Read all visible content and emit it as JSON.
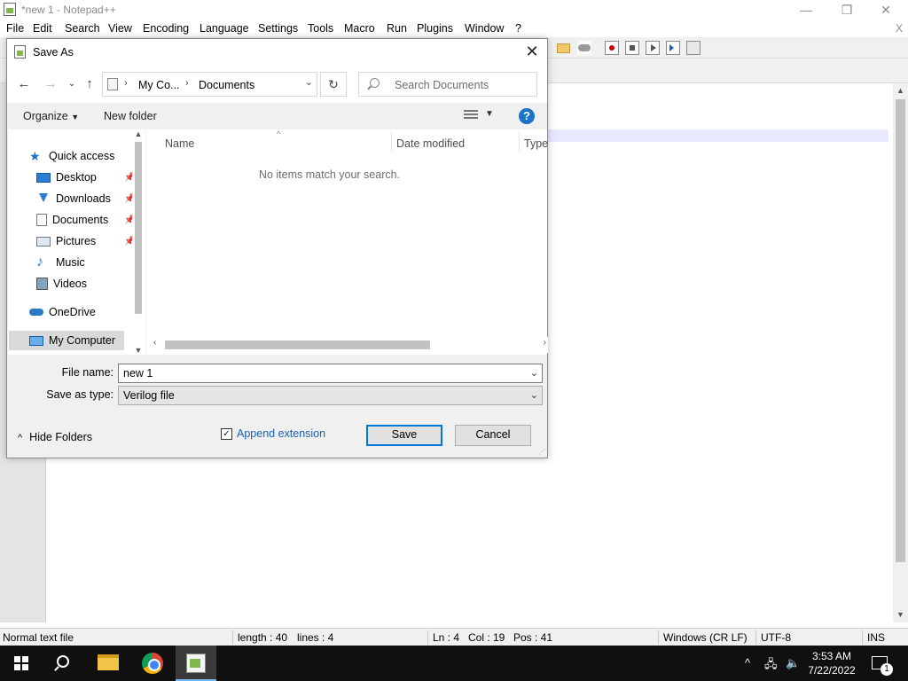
{
  "notepad": {
    "title": "*new 1 - Notepad++",
    "menu": [
      "File",
      "Edit",
      "Search",
      "View",
      "Encoding",
      "Language",
      "Settings",
      "Tools",
      "Macro",
      "Run",
      "Plugins",
      "Window",
      "?"
    ],
    "menu_close": "X",
    "window_controls": {
      "minimize": "—",
      "maximize": "❐",
      "close": "✕"
    },
    "status": {
      "file_type": "Normal text file",
      "length": "length : 40",
      "lines": "lines : 4",
      "ln": "Ln : 4",
      "col": "Col : 19",
      "pos": "Pos : 41",
      "eol": "Windows (CR LF)",
      "encoding": "UTF-8",
      "mode": "INS"
    }
  },
  "dialog": {
    "title": "Save As",
    "close_glyph": "✕",
    "address": {
      "crumb1": "My Co...",
      "crumb2": "Documents"
    },
    "search_placeholder": "Search Documents",
    "commands": {
      "organize": "Organize",
      "new_folder": "New folder",
      "help": "?"
    },
    "nav": {
      "quick_access": "Quick access",
      "items": [
        {
          "label": "Desktop",
          "icon": "desktop-icon",
          "pinned": true
        },
        {
          "label": "Downloads",
          "icon": "downloads-icon",
          "pinned": true
        },
        {
          "label": "Documents",
          "icon": "documents-icon",
          "pinned": true
        },
        {
          "label": "Pictures",
          "icon": "pictures-icon",
          "pinned": true
        },
        {
          "label": "Music",
          "icon": "music-icon",
          "pinned": false
        },
        {
          "label": "Videos",
          "icon": "videos-icon",
          "pinned": false
        }
      ],
      "onedrive": "OneDrive",
      "my_computer": "My Computer"
    },
    "columns": {
      "name": "Name",
      "date_modified": "Date modified",
      "type": "Type"
    },
    "empty_message": "No items match your search.",
    "file_name_label": "File name:",
    "file_name_value": "new 1",
    "save_type_label": "Save as type:",
    "save_type_value": "Verilog file",
    "hide_folders": "Hide Folders",
    "append_extension": "Append extension",
    "append_extension_checked": true,
    "save_button": "Save",
    "cancel_button": "Cancel"
  },
  "taskbar": {
    "time": "3:53 AM",
    "date": "7/22/2022",
    "notification_count": "1"
  },
  "colors": {
    "accent": "#0078d7",
    "link": "#1a5fb4",
    "current_line": "#e8e8ff"
  }
}
